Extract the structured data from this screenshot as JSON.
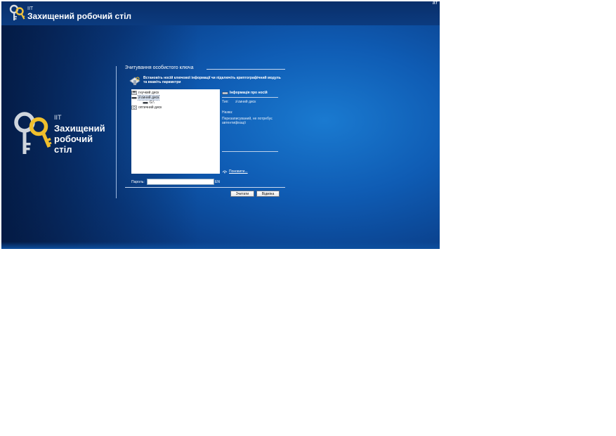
{
  "header": {
    "brand": "IIT",
    "title": "Захищений робочий стіл",
    "corner_badge": "IIT"
  },
  "left_branding": {
    "brand": "IIT",
    "title_lines": [
      "Захищений",
      "робочий",
      "стіл"
    ]
  },
  "panel": {
    "title": "Зчитування особистого ключа",
    "instruction": "Встановіть носій ключової інформації чи підключіть криптографічний модуль та вкажіть параметри",
    "tree": [
      {
        "label": "гнучкий диск",
        "icon": "floppy-drive-icon",
        "selected": false
      },
      {
        "label": "з'ємний диск",
        "icon": "removable-drive-icon",
        "selected": true
      },
      {
        "label": "G:\\",
        "icon": "drive-icon",
        "selected": false
      },
      {
        "label": "оптичний диск",
        "icon": "optical-drive-icon",
        "selected": false
      }
    ],
    "info": {
      "title": "Інформація про носій",
      "type_label": "Тип:",
      "type_value": "з'ємний диск",
      "name_label": "Назва:",
      "description": "Перезаписуваний, не потребує автентифікації",
      "refresh_link": "Поновити..."
    },
    "password": {
      "label": "Пароль:",
      "value": "",
      "placeholder": "",
      "lang": "EN"
    },
    "buttons": {
      "read": "Зчитати",
      "cancel": "Відміна"
    }
  },
  "colors": {
    "desktop_blue": "#0f5cb4",
    "desktop_dark": "#08306e",
    "button_face": "#e6e6e6"
  }
}
